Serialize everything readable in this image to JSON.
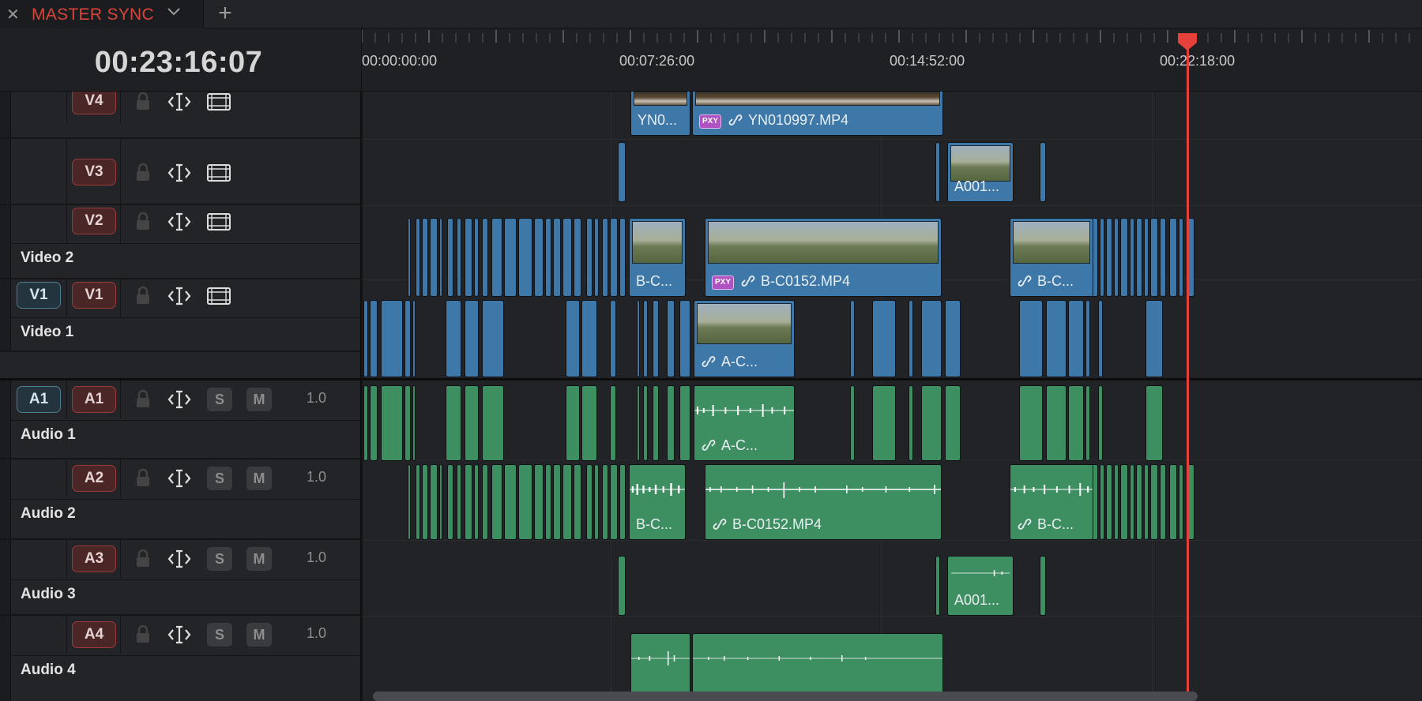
{
  "tab": {
    "title": "MASTER SYNC",
    "close_icon": "close-icon",
    "add_icon": "plus-icon"
  },
  "timecode": "00:23:16:07",
  "ruler": {
    "labels": [
      "00:00:00:00",
      "00:07:26:00",
      "00:14:52:00",
      "00:22:18:00"
    ]
  },
  "tracks": {
    "v4": {
      "dest": "V4"
    },
    "v3": {
      "dest": "V3"
    },
    "v2": {
      "dest": "V2",
      "name": "Video 2"
    },
    "v1": {
      "src": "V1",
      "dest": "V1",
      "name": "Video 1"
    },
    "a1": {
      "src": "A1",
      "dest": "A1",
      "name": "Audio 1",
      "solo": "S",
      "mute": "M",
      "volume": "1.0"
    },
    "a2": {
      "dest": "A2",
      "name": "Audio 2",
      "solo": "S",
      "mute": "M",
      "volume": "1.0"
    },
    "a3": {
      "dest": "A3",
      "name": "Audio 3",
      "solo": "S",
      "mute": "M",
      "volume": "1.0"
    },
    "a4": {
      "dest": "A4",
      "name": "Audio 4",
      "solo": "S",
      "mute": "M",
      "volume": "1.0"
    }
  },
  "clips": {
    "v4_a": "YN0...",
    "v4_b": "YN010997.MP4",
    "v3_a": "A001...",
    "v2_a": "B-C...",
    "v2_b": "B-C0152.MP4",
    "v2_c": "B-C...",
    "v1_a": "A-C...",
    "a1_a": "A-C...",
    "a2_a": "B-C...",
    "a2_b": "B-C0152.MP4",
    "a2_c": "B-C...",
    "a3_a": "A001...",
    "proxy_badge": "PXY"
  },
  "colors": {
    "video_clip": "#3e78a8",
    "audio_clip": "#3d8f62",
    "playhead": "#e5403a",
    "tab_title": "#d9453a"
  }
}
